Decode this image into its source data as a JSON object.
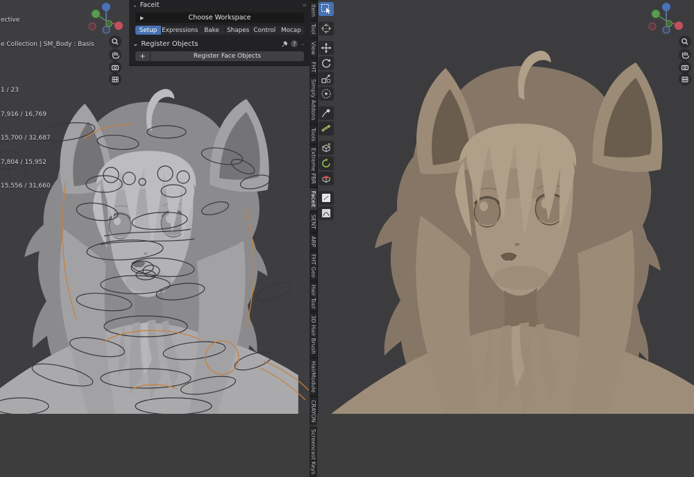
{
  "left_viewport": {
    "perspective_fragment": "ective",
    "collection_fragment": "e Collection | SM_Body : Basis",
    "stats": [
      "1 / 23",
      "7,916 / 16,769",
      "15,700 / 32,687",
      "7,804 / 15,952",
      "15,556 / 31,660"
    ]
  },
  "faceit_panel": {
    "title": "Faceit",
    "workspace_button": "Choose Workspace",
    "tabs": [
      {
        "label": "Setup",
        "active": true
      },
      {
        "label": "Expressions",
        "active": false
      },
      {
        "label": "Bake",
        "active": false
      },
      {
        "label": "Shapes",
        "active": false
      },
      {
        "label": "Control",
        "active": false
      },
      {
        "label": "Mocap",
        "active": false
      }
    ],
    "register_header": "Register Objects",
    "register_button": "Register Face Objects",
    "plus_label": "+"
  },
  "sidebar_tabs": [
    {
      "label": "Item",
      "active": false
    },
    {
      "label": "Tool",
      "active": false
    },
    {
      "label": "View",
      "active": false
    },
    {
      "label": "FHT",
      "active": false
    },
    {
      "label": "Simply Addons",
      "active": false
    },
    {
      "label": "Tools",
      "active": false
    },
    {
      "label": "Extreme PBR",
      "active": false
    },
    {
      "label": "Faceit",
      "active": true
    },
    {
      "label": "SENT",
      "active": false
    },
    {
      "label": "ARP",
      "active": false
    },
    {
      "label": "FHT Geo",
      "active": false
    },
    {
      "label": "Hair Tool",
      "active": false
    },
    {
      "label": "3D Hair Brush",
      "active": false
    },
    {
      "label": "HairModule",
      "active": false
    },
    {
      "label": "CRAYON",
      "active": false
    },
    {
      "label": "Screencast Keys",
      "active": false
    }
  ],
  "toolbar": {
    "tools": [
      "select-box",
      "cursor",
      "move",
      "rotate",
      "scale",
      "transform",
      "annotate",
      "measure",
      "add-cube",
      "spin",
      "extrude",
      "brush-preview-1",
      "brush-preview-2"
    ],
    "active_tool": "select-box"
  },
  "icons": {
    "chevron_down": "⌄",
    "play": "▶",
    "drag": "≡",
    "help": "?"
  },
  "colors": {
    "viewport_bg": "#3d3d3e",
    "panel_bg": "#212124",
    "accent_blue": "#4772b3",
    "selection_orange": "#c9803c",
    "clay_model": "#a79681",
    "gray_model": "#b3b3b6"
  }
}
